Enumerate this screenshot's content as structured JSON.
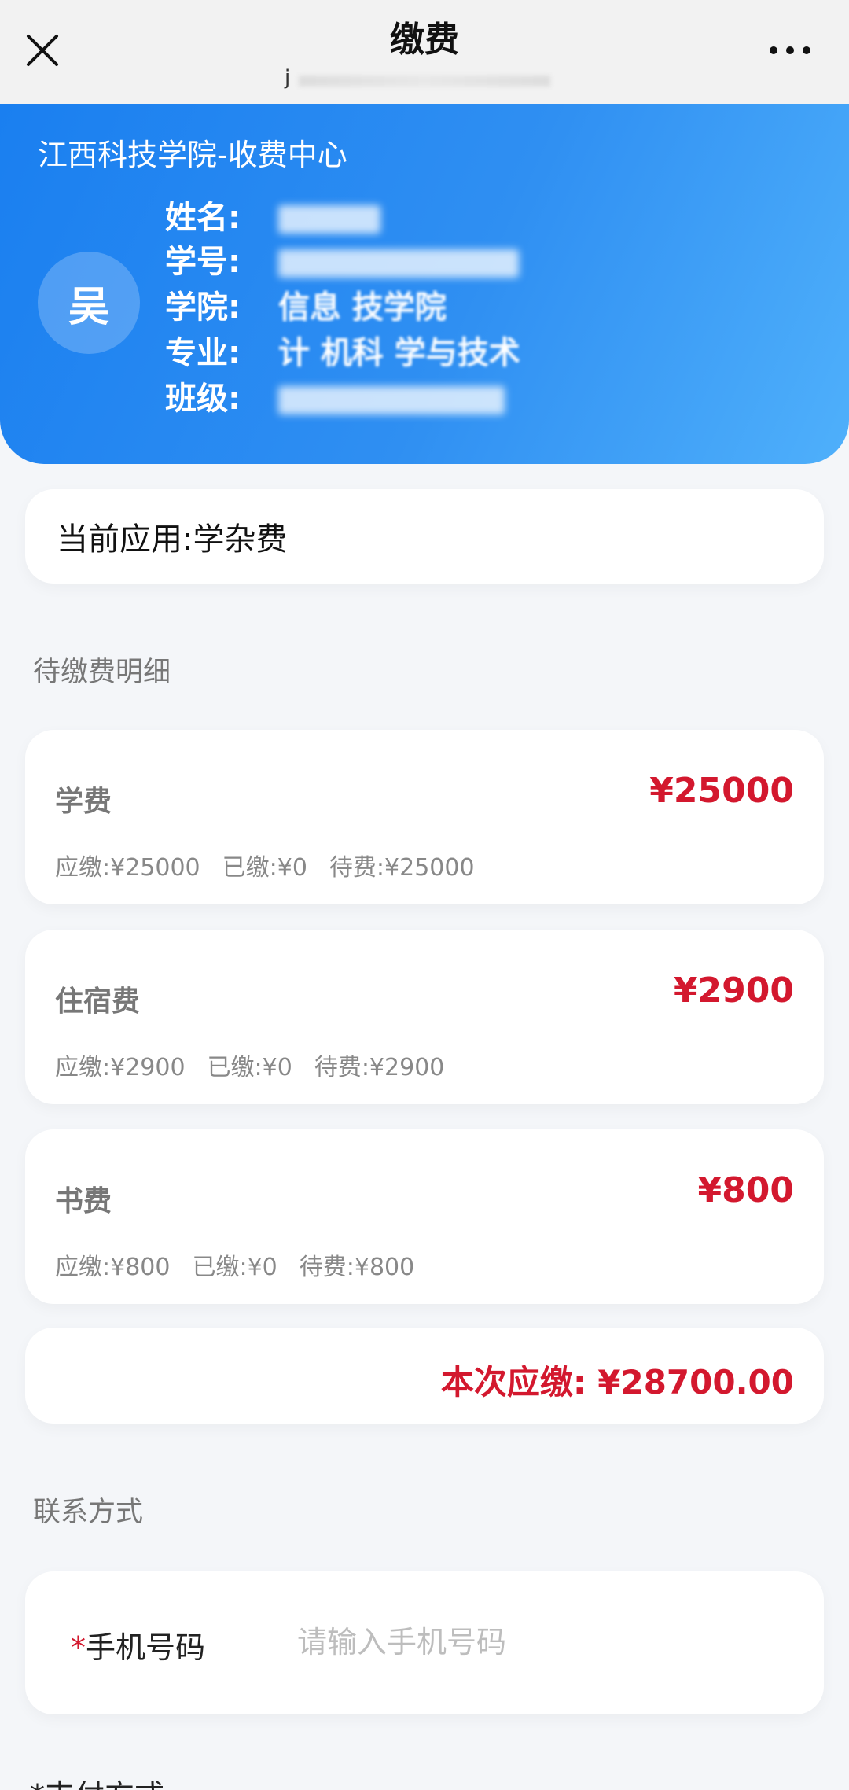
{
  "topbar": {
    "title": "缴费",
    "subtitle_glyph": "j"
  },
  "header": {
    "title": "江西科技学院-收费中心",
    "avatar_char": "吴",
    "rows": [
      {
        "label": "姓名:",
        "value": ""
      },
      {
        "label": "学号:",
        "value": ""
      },
      {
        "label": "学院:",
        "value": "信息 技学院"
      },
      {
        "label": "专业:",
        "value": "计 机科 学与技术"
      },
      {
        "label": "班级:",
        "value": ""
      }
    ]
  },
  "current_app": {
    "label": "当前应用:",
    "value": "学杂费"
  },
  "section_pending": "待缴费明细",
  "fees": [
    {
      "name": "学费",
      "amount": "¥25000",
      "due": "应缴:¥25000",
      "paid": "已缴:¥0",
      "pending": "待费:¥25000"
    },
    {
      "name": "住宿费",
      "amount": "¥2900",
      "due": "应缴:¥2900",
      "paid": "已缴:¥0",
      "pending": "待费:¥2900"
    },
    {
      "name": "书费",
      "amount": "¥800",
      "due": "应缴:¥800",
      "paid": "已缴:¥0",
      "pending": "待费:¥800"
    }
  ],
  "total": "本次应缴: ¥28700.00",
  "section_contact": "联系方式",
  "phone": {
    "required_mark": "*",
    "label": "手机号码",
    "placeholder": "请输入手机号码"
  },
  "next_section_partial": "*支付方式",
  "colors": {
    "header_blue": "#1a7ff0",
    "accent_red": "#d3182e"
  }
}
